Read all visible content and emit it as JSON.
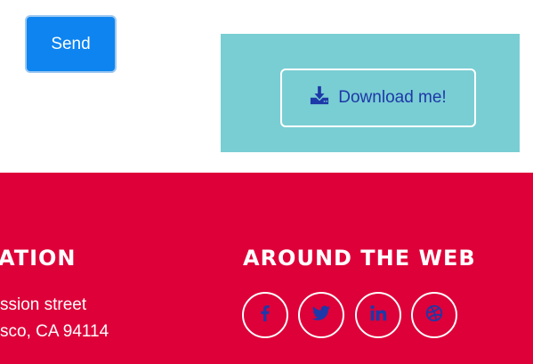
{
  "form": {
    "send_label": "Send"
  },
  "download": {
    "label": "Download me!",
    "icon": "download-icon"
  },
  "footer": {
    "location_heading": "ATION",
    "address_line_1": "ssion street",
    "address_line_2": "sco, CA 94114",
    "web_heading": "AROUND THE WEB",
    "social": [
      {
        "icon": "facebook-icon"
      },
      {
        "icon": "twitter-icon"
      },
      {
        "icon": "linkedin-icon"
      },
      {
        "icon": "dribbble-icon"
      }
    ]
  },
  "colors": {
    "send_button": "#0d84f0",
    "download_panel": "#79ced3",
    "download_text": "#1d38a8",
    "footer_bg": "#de0039",
    "social_icon": "#1d38a8"
  }
}
